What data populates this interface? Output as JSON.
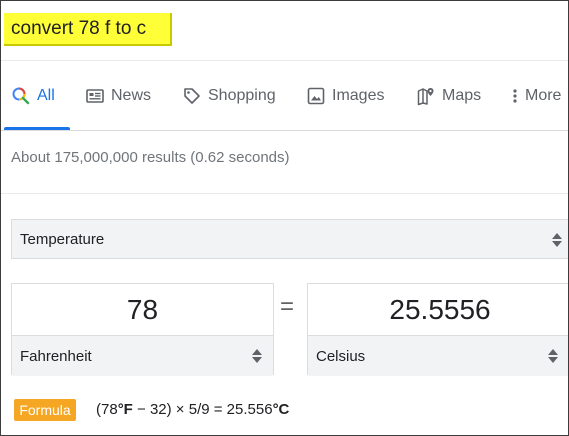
{
  "search": {
    "query": "convert 78 f to c"
  },
  "tabs": [
    {
      "label": "All",
      "icon": "search-icon",
      "active": true
    },
    {
      "label": "News",
      "icon": "news-icon"
    },
    {
      "label": "Shopping",
      "icon": "tag-icon"
    },
    {
      "label": "Images",
      "icon": "image-icon"
    },
    {
      "label": "Maps",
      "icon": "map-pin-icon"
    },
    {
      "label": "More",
      "icon": "more-vert-icon"
    }
  ],
  "result_stats": "About 175,000,000 results (0.62 seconds)",
  "converter": {
    "category": "Temperature",
    "equals": "=",
    "from": {
      "value": "78",
      "unit": "Fahrenheit"
    },
    "to": {
      "value": "25.5556",
      "unit": "Celsius"
    },
    "formula_label": "Formula",
    "formula": {
      "open": "(78",
      "unit_f": "°F",
      "middle": " − 32) × 5/9 = 25.556",
      "unit_c": "°C"
    }
  },
  "colors": {
    "accent": "#1a73e8",
    "highlight": "#ffff38",
    "formula_badge": "#f5a623"
  }
}
